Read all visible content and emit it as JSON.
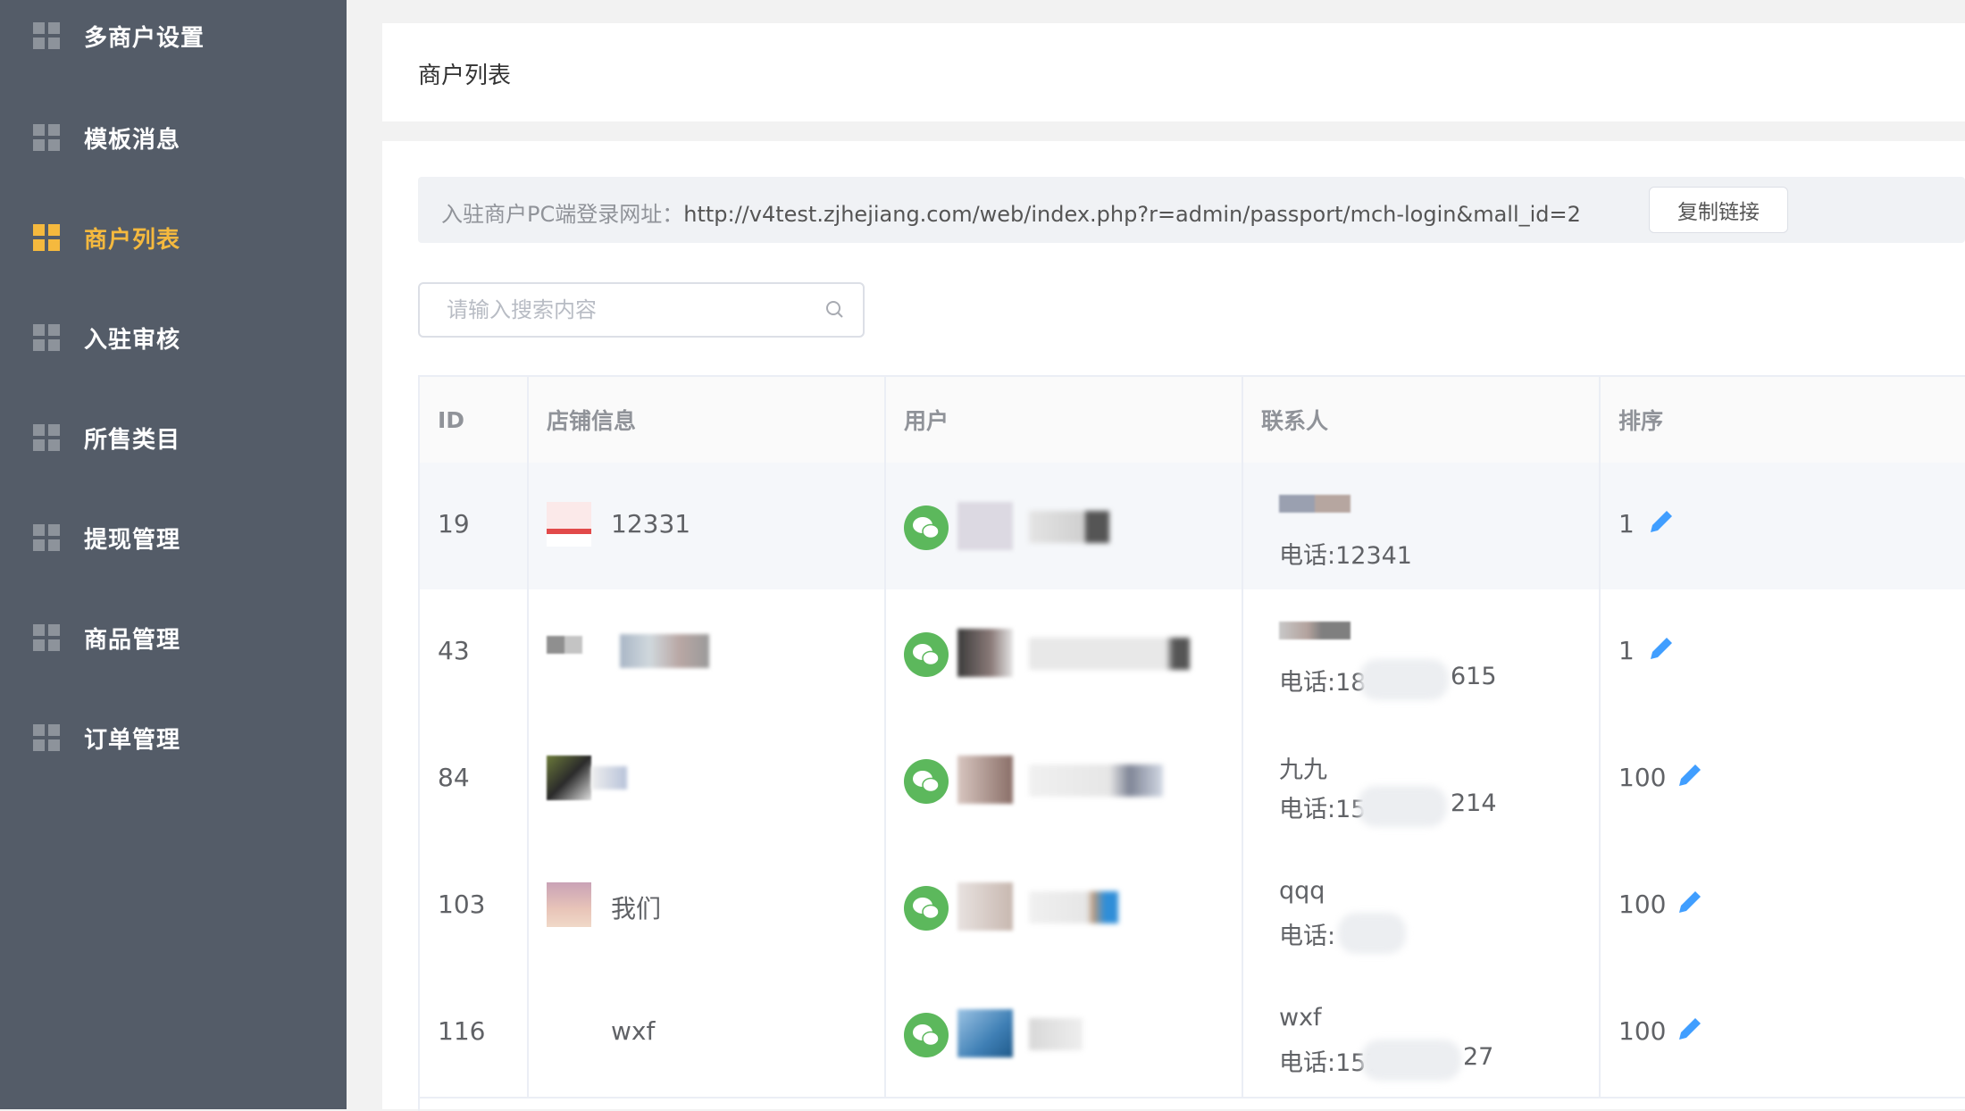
{
  "sidebar": {
    "items": [
      {
        "label": "多商户设置",
        "active": false
      },
      {
        "label": "模板消息",
        "active": false
      },
      {
        "label": "商户列表",
        "active": true
      },
      {
        "label": "入驻审核",
        "active": false
      },
      {
        "label": "所售类目",
        "active": false
      },
      {
        "label": "提现管理",
        "active": false
      },
      {
        "label": "商品管理",
        "active": false
      },
      {
        "label": "订单管理",
        "active": false
      }
    ]
  },
  "header": {
    "title": "商户列表"
  },
  "notice": {
    "label": "入驻商户PC端登录网址：",
    "url": "http://v4test.zjhejiang.com/web/index.php?r=admin/passport/mch-login&mall_id=2",
    "copy_button": "复制链接"
  },
  "search": {
    "placeholder": "请输入搜索内容",
    "value": ""
  },
  "table": {
    "headers": [
      "ID",
      "店铺信息",
      "用户",
      "联系人",
      "排序"
    ],
    "rows": [
      {
        "id": "19",
        "shop_name": "12331",
        "contact_name": "",
        "phone": "电话:12341",
        "sort": "1"
      },
      {
        "id": "43",
        "shop_name": "",
        "contact_name": "",
        "phone": "电话:18",
        "phone_tail": "615",
        "sort": "1"
      },
      {
        "id": "84",
        "shop_name": "",
        "contact_name": "九九",
        "phone": "电话:15",
        "phone_tail": "214",
        "sort": "100"
      },
      {
        "id": "103",
        "shop_name": "我们",
        "contact_name": "qqq",
        "phone": "电话:",
        "sort": "100"
      },
      {
        "id": "116",
        "shop_name": "wxf",
        "contact_name": "wxf",
        "phone": "电话:157",
        "phone_tail": "27",
        "sort": "100"
      }
    ]
  },
  "colors": {
    "sidebar_bg": "#545c68",
    "accent": "#f5b93e",
    "wechat": "#5cb85c",
    "edit": "#409eff"
  }
}
